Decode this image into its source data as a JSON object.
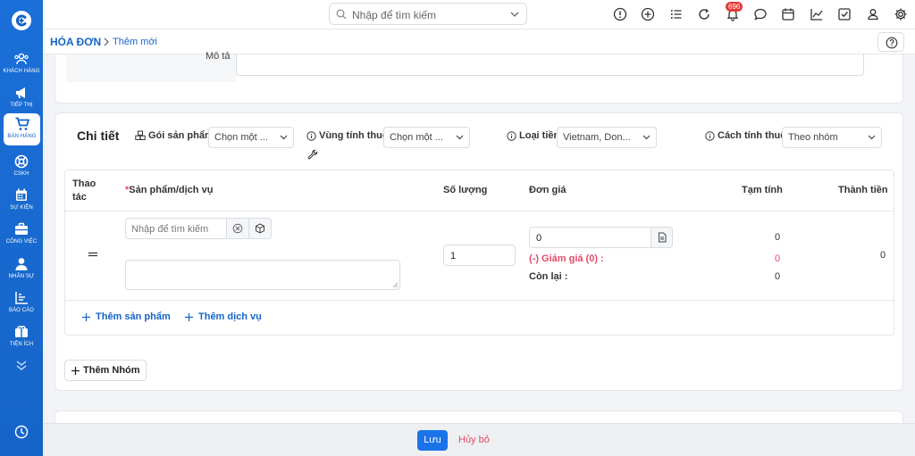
{
  "sidebar": {
    "items": [
      {
        "label": "KHÁCH HÀNG",
        "icon": "customers-icon"
      },
      {
        "label": "TIẾP THỊ",
        "icon": "megaphone-icon"
      },
      {
        "label": "BÁN HÀNG",
        "icon": "cart-icon",
        "active": true
      },
      {
        "label": "CSKH",
        "icon": "support-icon"
      },
      {
        "label": "SỰ KIỆN",
        "icon": "calendar-icon"
      },
      {
        "label": "CÔNG VIỆC",
        "icon": "briefcase-icon"
      },
      {
        "label": "NHÂN SỰ",
        "icon": "person-icon"
      },
      {
        "label": "BÁO CÁO",
        "icon": "report-icon"
      },
      {
        "label": "TIỆN ÍCH",
        "icon": "utilities-icon"
      }
    ]
  },
  "topbar": {
    "search_placeholder": "Nhập để tìm kiếm",
    "notification_count": "696"
  },
  "breadcrumb": {
    "main": "HÓA ĐƠN",
    "sub": "Thêm mới"
  },
  "description": {
    "label": "Mô tả"
  },
  "details": {
    "title": "Chi tiết",
    "fields": {
      "package_label": "Gói sản phẩm",
      "package_value": "Chọn một ...",
      "tax_region_label": "Vùng tính thuế",
      "tax_region_value": "Chọn một ...",
      "currency_label": "Loại tiền",
      "currency_value": "Vietnam, Don...",
      "calc_label": "Cách tính thuế",
      "calc_value": "Theo nhóm"
    },
    "table": {
      "headers": {
        "action": "Thao tác",
        "product_required": "*",
        "product": "Sản phẩm/dịch vụ",
        "quantity": "Số lượng",
        "unit_price": "Đơn giá",
        "subtotal": "Tạm tính",
        "total": "Thành tiền"
      },
      "row": {
        "product_search_placeholder": "Nhập để tìm kiếm",
        "quantity": "1",
        "unit_price": "0",
        "discount_label": "(-) Giảm giá (0) :",
        "remaining_label": "Còn lại :",
        "subtotal": "0",
        "discount_value": "0",
        "remaining_value": "0",
        "total": "0"
      },
      "add_product": "Thêm sản phẩm",
      "add_service": "Thêm dịch vụ"
    },
    "add_group": "Thêm Nhóm"
  },
  "footer": {
    "save": "Lưu",
    "cancel": "Hủy bỏ"
  },
  "colors": {
    "primary": "#1a73e8",
    "danger": "#e24a6a",
    "badge": "#e53935"
  }
}
